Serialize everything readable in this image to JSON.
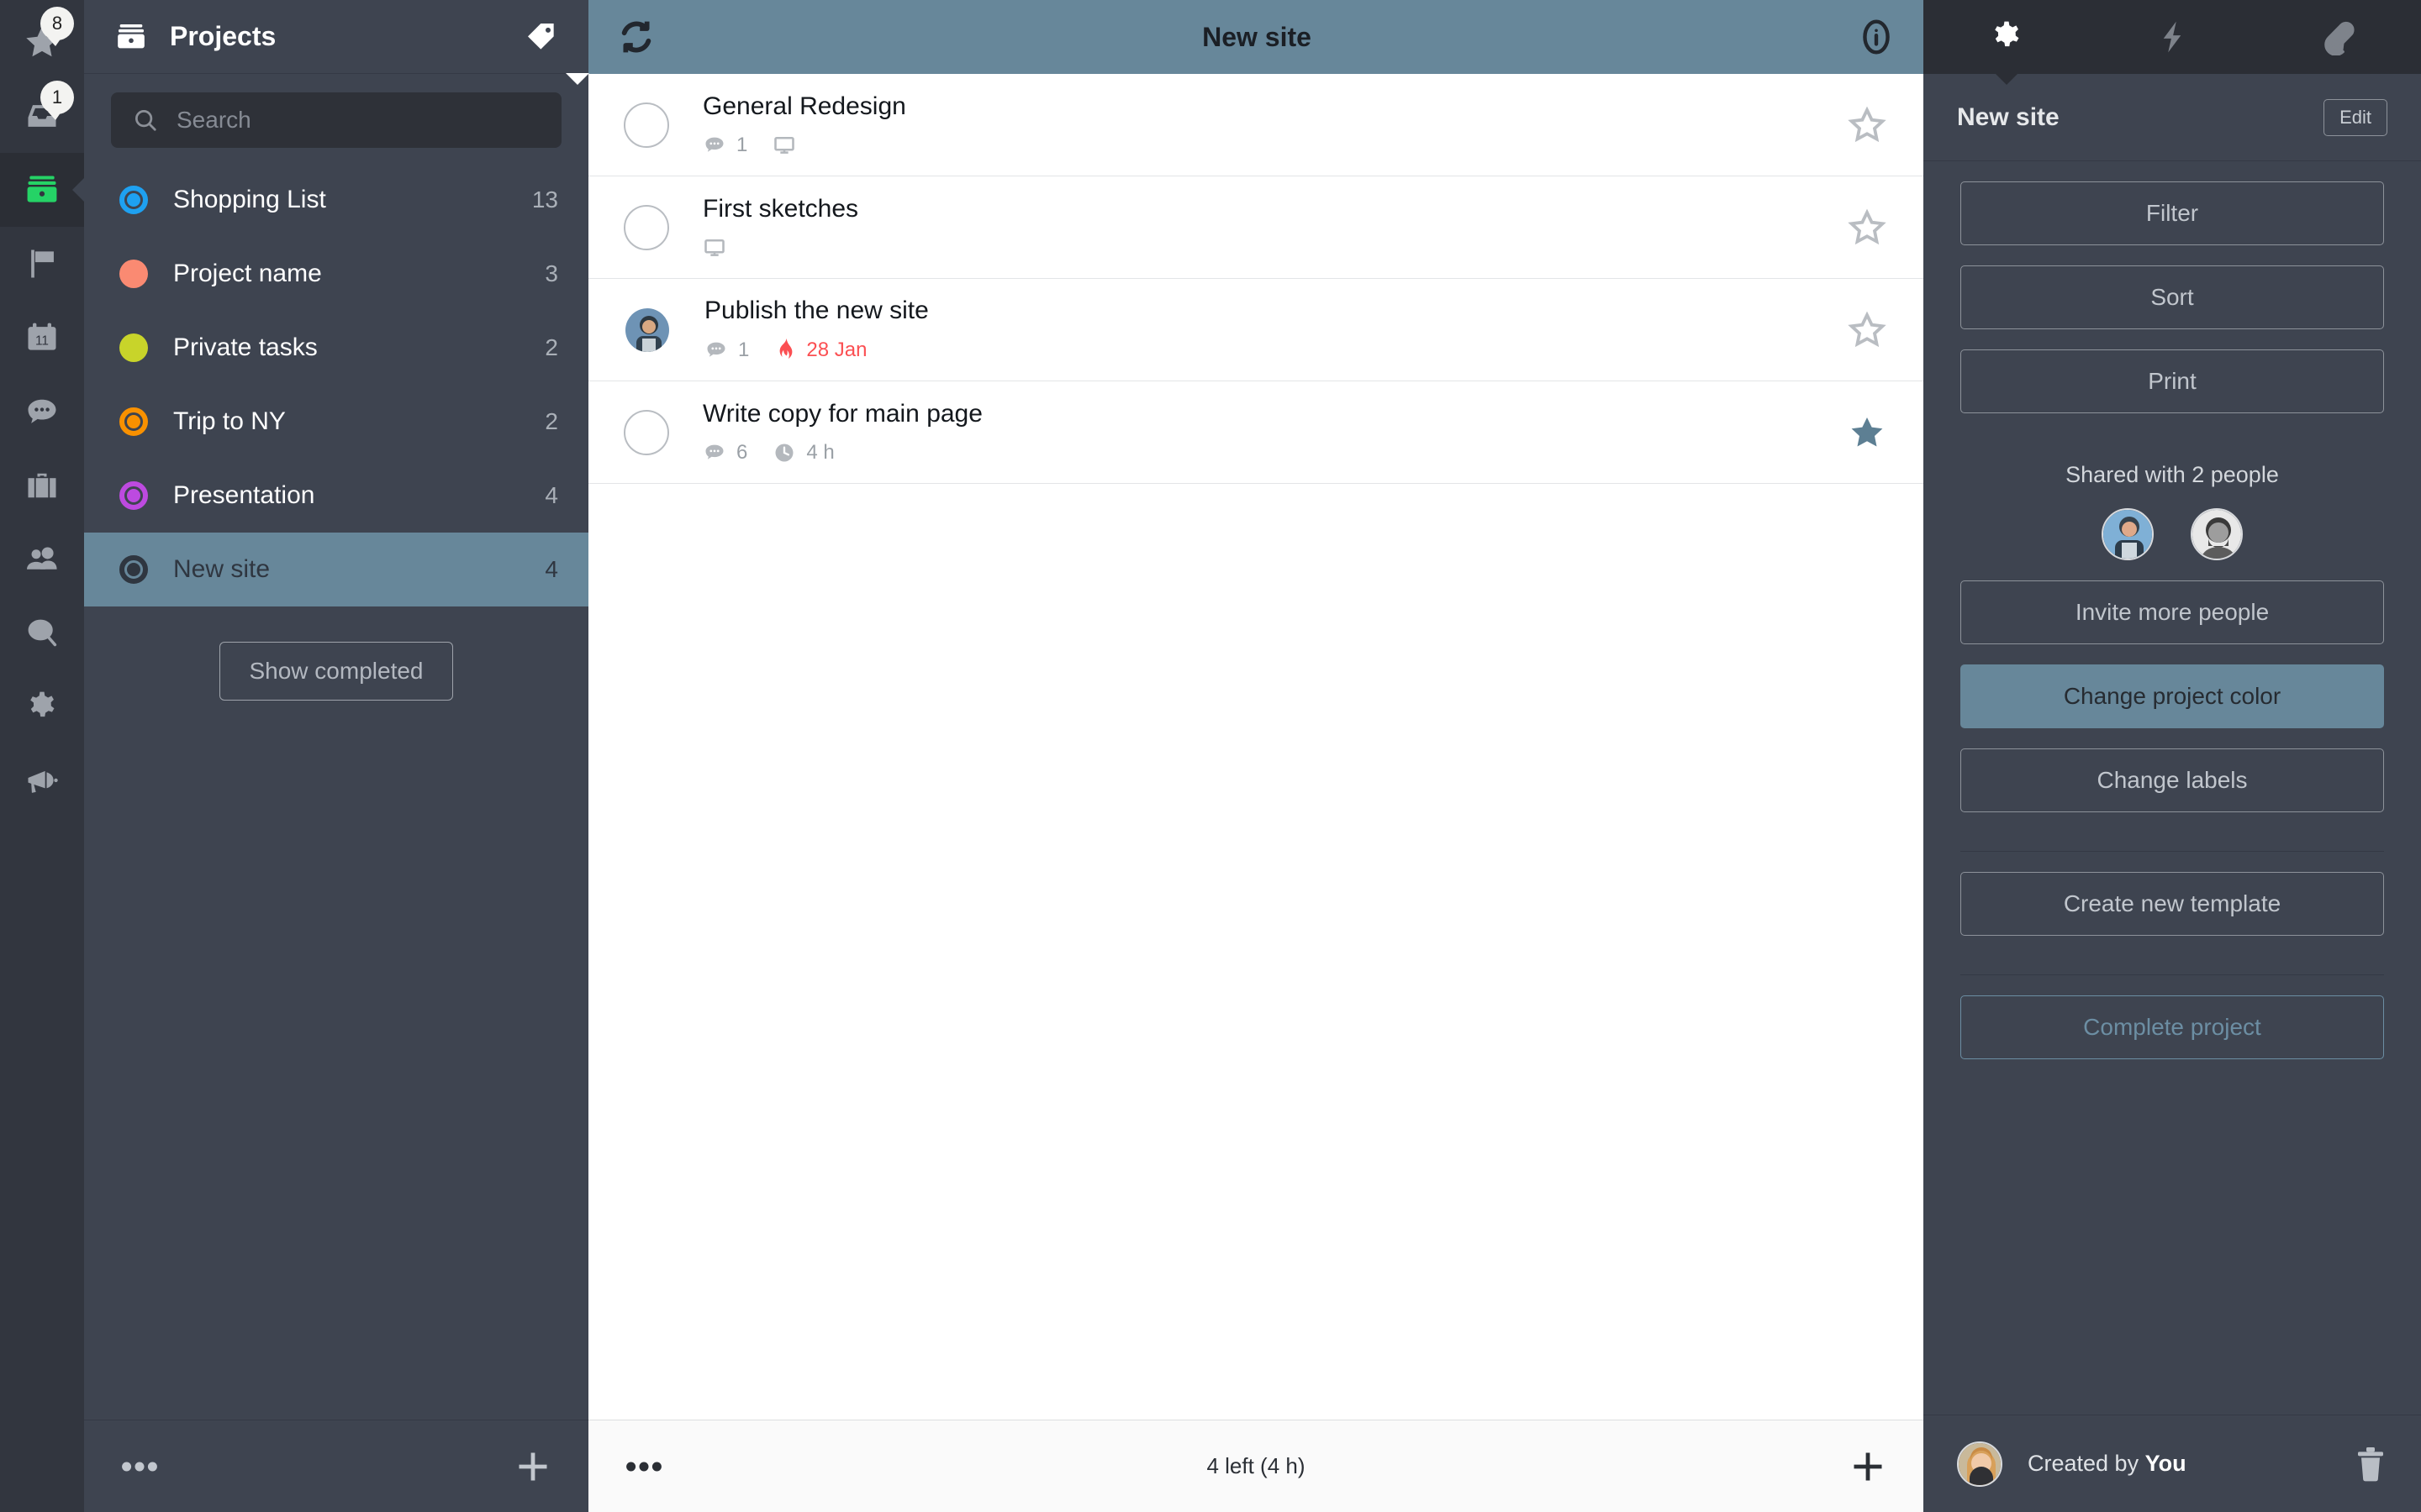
{
  "rail": {
    "items": [
      {
        "icon": "star-icon",
        "badge": "8",
        "active": false
      },
      {
        "icon": "inbox-icon",
        "badge": "1",
        "active": false
      },
      {
        "icon": "projects-icon",
        "badge": "",
        "active": true
      },
      {
        "icon": "flag-icon",
        "badge": "",
        "active": false
      },
      {
        "icon": "calendar-icon",
        "badge": "",
        "active": false
      },
      {
        "icon": "chat-icon",
        "badge": "",
        "active": false
      },
      {
        "icon": "briefcase-icon",
        "badge": "",
        "active": false
      },
      {
        "icon": "people-icon",
        "badge": "",
        "active": false
      },
      {
        "icon": "search-icon",
        "badge": "",
        "active": false
      },
      {
        "icon": "gear-icon",
        "badge": "",
        "active": false
      },
      {
        "icon": "megaphone-icon",
        "badge": "",
        "active": false
      }
    ]
  },
  "sidebar": {
    "title": "Projects",
    "header_icon": "projects-icon",
    "tag_icon": "tag-icon",
    "search": {
      "value": "",
      "placeholder": "Search",
      "icon": "search-icon"
    },
    "projects": [
      {
        "name": "Shopping List",
        "count": "13",
        "color": "#1ea1f1",
        "style": "ring",
        "selected": false
      },
      {
        "name": "Project name",
        "count": "3",
        "color": "#fa8a72",
        "style": "solid",
        "selected": false
      },
      {
        "name": "Private tasks",
        "count": "2",
        "color": "#c8d42a",
        "style": "solid",
        "selected": false
      },
      {
        "name": "Trip to NY",
        "count": "2",
        "color": "#f99100",
        "style": "ring",
        "selected": false
      },
      {
        "name": "Presentation",
        "count": "4",
        "color": "#bd4ae0",
        "style": "ring",
        "selected": false
      },
      {
        "name": "New site",
        "count": "4",
        "color": "#2f3640",
        "style": "ring",
        "selected": true
      }
    ],
    "show_completed_label": "Show completed",
    "footer": {
      "more_icon": "more-icon",
      "add_icon": "plus-icon"
    }
  },
  "center": {
    "header": {
      "sync_icon": "sync-icon",
      "title": "New site",
      "info_icon": "info-icon"
    },
    "tasks": [
      {
        "title": "General Redesign",
        "marker": "checkbox",
        "comments": "1",
        "has_device": true,
        "due": "",
        "time": "",
        "starred": false
      },
      {
        "title": "First sketches",
        "marker": "checkbox",
        "comments": "",
        "has_device": true,
        "due": "",
        "time": "",
        "starred": false
      },
      {
        "title": "Publish the new site",
        "marker": "avatar",
        "comments": "1",
        "has_device": false,
        "due": "28 Jan",
        "time": "",
        "starred": false
      },
      {
        "title": "Write copy for main page",
        "marker": "checkbox",
        "comments": "6",
        "has_device": false,
        "due": "",
        "time": "4 h",
        "starred": true
      }
    ],
    "footer": {
      "more_icon": "more-icon",
      "status": "4 left (4 h)",
      "add_icon": "plus-icon"
    }
  },
  "right": {
    "tabs": [
      {
        "icon": "gear-icon",
        "active": true
      },
      {
        "icon": "lightning-icon",
        "active": false
      },
      {
        "icon": "paperclip-icon",
        "active": false
      }
    ],
    "project_title": "New site",
    "edit_label": "Edit",
    "actions": [
      "Filter",
      "Sort",
      "Print"
    ],
    "shared_label": "Shared with 2 people",
    "invite_label": "Invite more people",
    "change_color_label": "Change project color",
    "change_labels_label": "Change labels",
    "create_template_label": "Create new template",
    "complete_project_label": "Complete project",
    "created_by_prefix": "Created by ",
    "created_by_name": "You",
    "delete_icon": "trash-icon"
  },
  "colors": {
    "accent": "#67879a",
    "panel_bg": "#3e4450",
    "rail_bg": "#32363f",
    "due_red": "#fb4f52"
  }
}
